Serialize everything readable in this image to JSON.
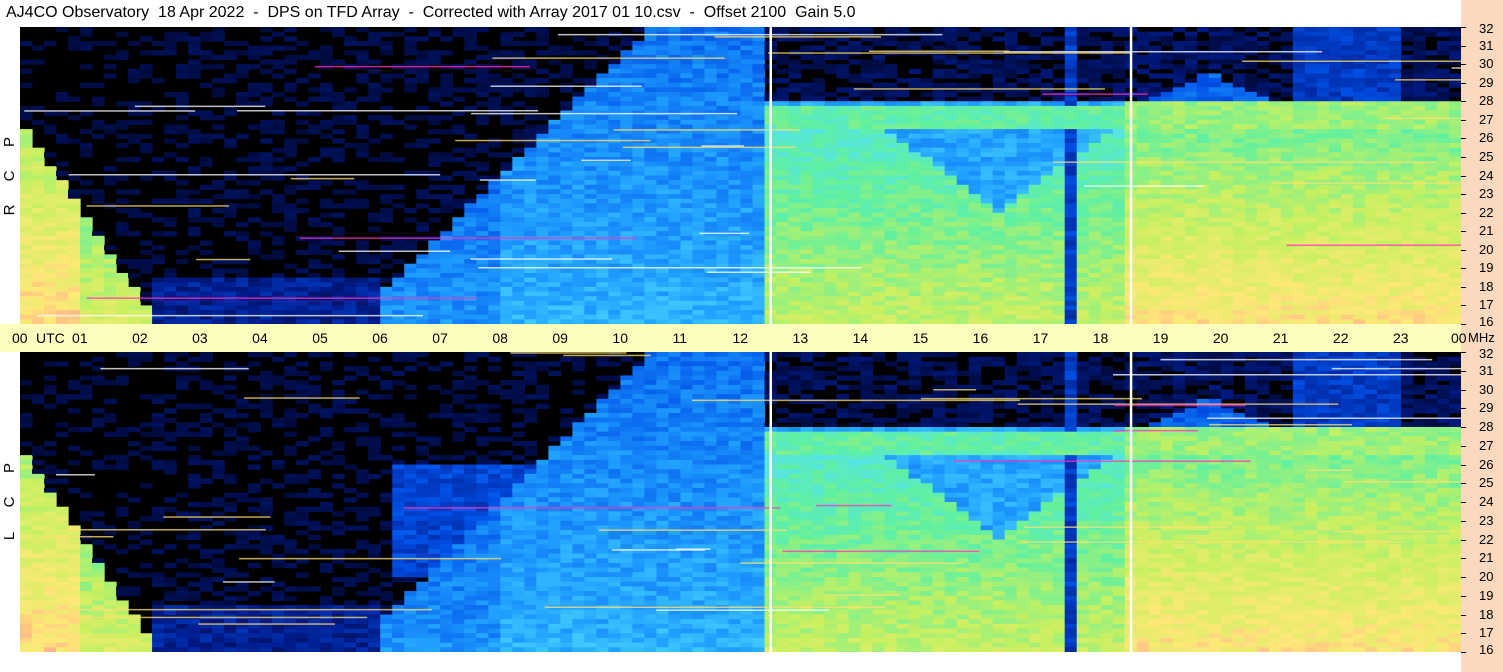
{
  "title": "AJ4CO Observatory  18 Apr 2022  -  DPS on TFD Array  -  Corrected with Array 2017 01 10.csv  -  Offset 2100  Gain 5.0",
  "colors": {
    "background": "#000000",
    "time_band": "#fdfdbe",
    "freq_column": "#fbd9be",
    "colormap": [
      "#000010",
      "#001c8c",
      "#0050e6",
      "#1e9cff",
      "#50e0ff",
      "#60f0a0",
      "#c8f060",
      "#ffe878",
      "#ff8898",
      "#ff20c0"
    ]
  },
  "chart_data": [
    {
      "type": "heatmap",
      "panel": "RCP",
      "polarization_label": [
        "R",
        "C",
        "P"
      ],
      "x_ticks": [
        "00",
        "UTC",
        "01",
        "02",
        "03",
        "04",
        "05",
        "06",
        "07",
        "08",
        "09",
        "10",
        "11",
        "12",
        "13",
        "14",
        "15",
        "16",
        "17",
        "18",
        "19",
        "20",
        "21",
        "22",
        "23",
        "00"
      ],
      "x_unit": "UTC",
      "xlim": [
        0,
        24
      ],
      "y_ticks": [
        "32",
        "31",
        "30",
        "29",
        "28",
        "27",
        "26",
        "25",
        "24",
        "23",
        "22",
        "21",
        "20",
        "19",
        "18",
        "17",
        "16"
      ],
      "y_unit": "MHz",
      "ylim": [
        16,
        32
      ],
      "markers_utc": [
        12.5,
        18.5
      ],
      "grid": false
    },
    {
      "type": "heatmap",
      "panel": "LCP",
      "polarization_label": [
        "L",
        "C",
        "P"
      ],
      "y_ticks": [
        "32",
        "31",
        "30",
        "29",
        "28",
        "27",
        "26",
        "25",
        "24",
        "23",
        "22",
        "21",
        "20",
        "19",
        "18",
        "17",
        "16"
      ],
      "y_unit": "MHz",
      "ylim": [
        16,
        32
      ],
      "markers_utc": [
        12.5,
        18.5
      ],
      "grid": false
    }
  ]
}
